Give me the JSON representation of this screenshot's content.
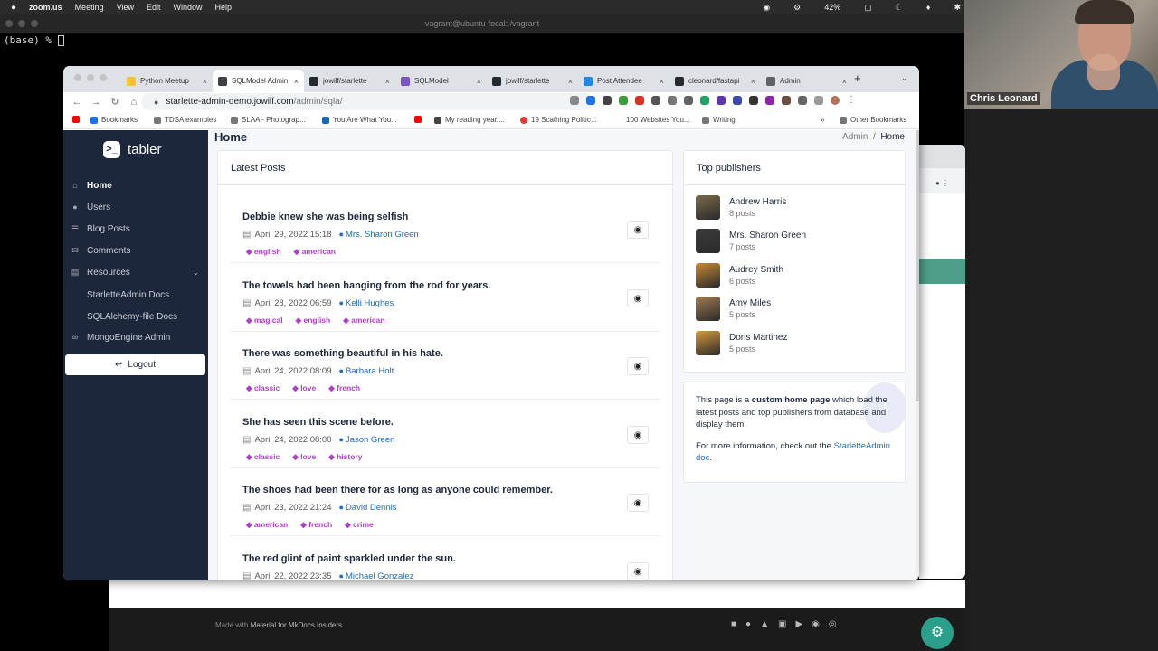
{
  "mac_menu": {
    "apple": "",
    "app": "zoom.us",
    "items": [
      "Meeting",
      "View",
      "Edit",
      "Window",
      "Help"
    ],
    "battery": "42%"
  },
  "terminal": {
    "title": "vagrant@ubuntu-focal: /vagrant",
    "prompt": "(base) % "
  },
  "webcam": {
    "participant": "Chris Leonard"
  },
  "browser": {
    "tabs": [
      {
        "label": "Python Meetup",
        "color": "#f4c430"
      },
      {
        "label": "SQLModel Admin",
        "color": "#3c4043",
        "active": true
      },
      {
        "label": "jowilf/starlette",
        "color": "#24292f"
      },
      {
        "label": "SQLModel",
        "color": "#7e56c2"
      },
      {
        "label": "jowilf/starlette",
        "color": "#24292f"
      },
      {
        "label": "Post Attendee",
        "color": "#1e88e5"
      },
      {
        "label": "cleonard/fastapi",
        "color": "#24292f"
      },
      {
        "label": "Admin",
        "color": "#5f6368"
      }
    ],
    "url_host": "starlette-admin-demo.jowilf.com",
    "url_path": "/admin/sqla/",
    "bookmarks": [
      "Bookmarks",
      "TDSA examples",
      "SLAA - Photograp...",
      "You Are What You...",
      "My reading year,...",
      "19 Scathing Politic...",
      "100 Websites You...",
      "Writing"
    ],
    "bookmarks_more": "»",
    "other_bookmarks": "Other Bookmarks"
  },
  "sidebar": {
    "brand": "tabler",
    "brand_mark": ">_",
    "items": [
      {
        "label": "Home",
        "icon": "home-icon"
      },
      {
        "label": "Users",
        "icon": "user-icon"
      },
      {
        "label": "Blog Posts",
        "icon": "list-icon"
      },
      {
        "label": "Comments",
        "icon": "comment-icon"
      },
      {
        "label": "Resources",
        "icon": "book-icon"
      }
    ],
    "sub_items": [
      "StarletteAdmin Docs",
      "SQLAlchemy-file Docs"
    ],
    "mongo": "MongoEngine Admin",
    "logout": "Logout"
  },
  "page": {
    "title": "Home",
    "breadcrumb_parent": "Admin",
    "breadcrumb_sep": "/",
    "breadcrumb_current": "Home"
  },
  "latest_posts": {
    "heading": "Latest Posts",
    "posts": [
      {
        "title": "Debbie knew she was being selfish",
        "date": "April 29, 2022 15:18",
        "author": "Mrs. Sharon Green",
        "tags": [
          "english",
          "american"
        ]
      },
      {
        "title": "The towels had been hanging from the rod for years.",
        "date": "April 28, 2022 06:59",
        "author": "Kelli Hughes",
        "tags": [
          "magical",
          "english",
          "american"
        ]
      },
      {
        "title": "There was something beautiful in his hate.",
        "date": "April 24, 2022 08:09",
        "author": "Barbara Holt",
        "tags": [
          "classic",
          "love",
          "french"
        ]
      },
      {
        "title": "She has seen this scene before.",
        "date": "April 24, 2022 08:00",
        "author": "Jason Green",
        "tags": [
          "classic",
          "love",
          "history"
        ]
      },
      {
        "title": "The shoes had been there for as long as anyone could remember.",
        "date": "April 23, 2022 21:24",
        "author": "David Dennis",
        "tags": [
          "american",
          "french",
          "crime"
        ]
      },
      {
        "title": "The red glint of paint sparkled under the sun.",
        "date": "April 22, 2022 23:35",
        "author": "Michael Gonzalez",
        "tags": []
      }
    ]
  },
  "top_publishers": {
    "heading": "Top publishers",
    "items": [
      {
        "name": "Andrew Harris",
        "count": "8 posts",
        "color": "#7a6a4c"
      },
      {
        "name": "Mrs. Sharon Green",
        "count": "7 posts",
        "color": "#3c3c3c"
      },
      {
        "name": "Audrey Smith",
        "count": "6 posts",
        "color": "#c98a35"
      },
      {
        "name": "Amy Miles",
        "count": "5 posts",
        "color": "#a07b52"
      },
      {
        "name": "Doris Martinez",
        "count": "5 posts",
        "color": "#d59a3a"
      }
    ]
  },
  "info": {
    "p1_pre": "This page is a ",
    "p1_bold": "custom home page",
    "p1_post": " which load the latest posts and top publishers from database and display them.",
    "p2_pre": "For more information, check out the ",
    "p2_link": "StarletteAdmin doc",
    "p2_post": "."
  },
  "docs_footer": {
    "made_pre": "Made with ",
    "made_link": "Material for MkDocs Insiders"
  },
  "colors": {
    "sidebar_bg": "#1d273b",
    "link": "#206bc4",
    "tag": "#ae3ec9"
  }
}
